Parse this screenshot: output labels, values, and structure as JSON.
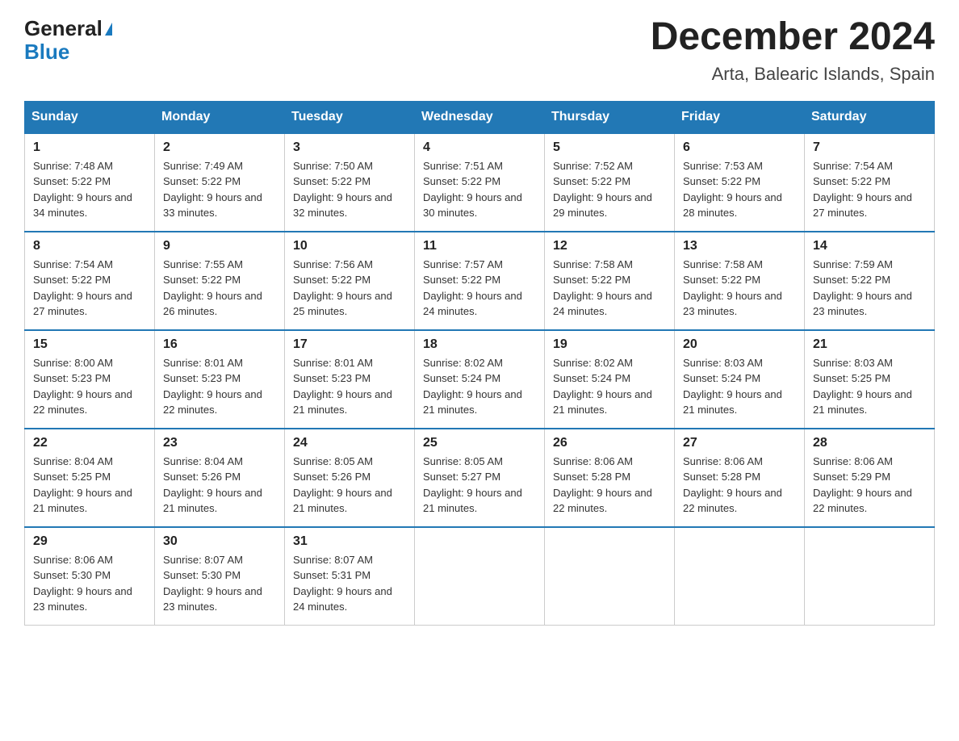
{
  "header": {
    "logo_general": "General",
    "logo_blue": "Blue",
    "month_title": "December 2024",
    "location": "Arta, Balearic Islands, Spain"
  },
  "days_of_week": [
    "Sunday",
    "Monday",
    "Tuesday",
    "Wednesday",
    "Thursday",
    "Friday",
    "Saturday"
  ],
  "weeks": [
    [
      {
        "day": "1",
        "sunrise": "7:48 AM",
        "sunset": "5:22 PM",
        "daylight": "9 hours and 34 minutes."
      },
      {
        "day": "2",
        "sunrise": "7:49 AM",
        "sunset": "5:22 PM",
        "daylight": "9 hours and 33 minutes."
      },
      {
        "day": "3",
        "sunrise": "7:50 AM",
        "sunset": "5:22 PM",
        "daylight": "9 hours and 32 minutes."
      },
      {
        "day": "4",
        "sunrise": "7:51 AM",
        "sunset": "5:22 PM",
        "daylight": "9 hours and 30 minutes."
      },
      {
        "day": "5",
        "sunrise": "7:52 AM",
        "sunset": "5:22 PM",
        "daylight": "9 hours and 29 minutes."
      },
      {
        "day": "6",
        "sunrise": "7:53 AM",
        "sunset": "5:22 PM",
        "daylight": "9 hours and 28 minutes."
      },
      {
        "day": "7",
        "sunrise": "7:54 AM",
        "sunset": "5:22 PM",
        "daylight": "9 hours and 27 minutes."
      }
    ],
    [
      {
        "day": "8",
        "sunrise": "7:54 AM",
        "sunset": "5:22 PM",
        "daylight": "9 hours and 27 minutes."
      },
      {
        "day": "9",
        "sunrise": "7:55 AM",
        "sunset": "5:22 PM",
        "daylight": "9 hours and 26 minutes."
      },
      {
        "day": "10",
        "sunrise": "7:56 AM",
        "sunset": "5:22 PM",
        "daylight": "9 hours and 25 minutes."
      },
      {
        "day": "11",
        "sunrise": "7:57 AM",
        "sunset": "5:22 PM",
        "daylight": "9 hours and 24 minutes."
      },
      {
        "day": "12",
        "sunrise": "7:58 AM",
        "sunset": "5:22 PM",
        "daylight": "9 hours and 24 minutes."
      },
      {
        "day": "13",
        "sunrise": "7:58 AM",
        "sunset": "5:22 PM",
        "daylight": "9 hours and 23 minutes."
      },
      {
        "day": "14",
        "sunrise": "7:59 AM",
        "sunset": "5:22 PM",
        "daylight": "9 hours and 23 minutes."
      }
    ],
    [
      {
        "day": "15",
        "sunrise": "8:00 AM",
        "sunset": "5:23 PM",
        "daylight": "9 hours and 22 minutes."
      },
      {
        "day": "16",
        "sunrise": "8:01 AM",
        "sunset": "5:23 PM",
        "daylight": "9 hours and 22 minutes."
      },
      {
        "day": "17",
        "sunrise": "8:01 AM",
        "sunset": "5:23 PM",
        "daylight": "9 hours and 21 minutes."
      },
      {
        "day": "18",
        "sunrise": "8:02 AM",
        "sunset": "5:24 PM",
        "daylight": "9 hours and 21 minutes."
      },
      {
        "day": "19",
        "sunrise": "8:02 AM",
        "sunset": "5:24 PM",
        "daylight": "9 hours and 21 minutes."
      },
      {
        "day": "20",
        "sunrise": "8:03 AM",
        "sunset": "5:24 PM",
        "daylight": "9 hours and 21 minutes."
      },
      {
        "day": "21",
        "sunrise": "8:03 AM",
        "sunset": "5:25 PM",
        "daylight": "9 hours and 21 minutes."
      }
    ],
    [
      {
        "day": "22",
        "sunrise": "8:04 AM",
        "sunset": "5:25 PM",
        "daylight": "9 hours and 21 minutes."
      },
      {
        "day": "23",
        "sunrise": "8:04 AM",
        "sunset": "5:26 PM",
        "daylight": "9 hours and 21 minutes."
      },
      {
        "day": "24",
        "sunrise": "8:05 AM",
        "sunset": "5:26 PM",
        "daylight": "9 hours and 21 minutes."
      },
      {
        "day": "25",
        "sunrise": "8:05 AM",
        "sunset": "5:27 PM",
        "daylight": "9 hours and 21 minutes."
      },
      {
        "day": "26",
        "sunrise": "8:06 AM",
        "sunset": "5:28 PM",
        "daylight": "9 hours and 22 minutes."
      },
      {
        "day": "27",
        "sunrise": "8:06 AM",
        "sunset": "5:28 PM",
        "daylight": "9 hours and 22 minutes."
      },
      {
        "day": "28",
        "sunrise": "8:06 AM",
        "sunset": "5:29 PM",
        "daylight": "9 hours and 22 minutes."
      }
    ],
    [
      {
        "day": "29",
        "sunrise": "8:06 AM",
        "sunset": "5:30 PM",
        "daylight": "9 hours and 23 minutes."
      },
      {
        "day": "30",
        "sunrise": "8:07 AM",
        "sunset": "5:30 PM",
        "daylight": "9 hours and 23 minutes."
      },
      {
        "day": "31",
        "sunrise": "8:07 AM",
        "sunset": "5:31 PM",
        "daylight": "9 hours and 24 minutes."
      },
      null,
      null,
      null,
      null
    ]
  ]
}
